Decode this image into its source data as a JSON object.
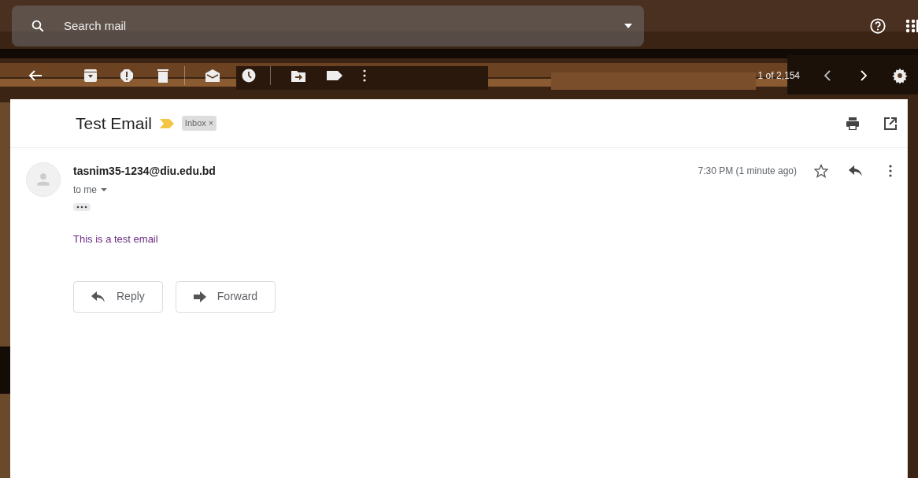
{
  "search": {
    "placeholder": "Search mail"
  },
  "toolbar": {
    "pagination": "1 of 2,154"
  },
  "message": {
    "subject": "Test Email",
    "important": true,
    "labels": [
      {
        "text": "Inbox",
        "close": "×"
      }
    ],
    "sender": "tasnim35-1234@diu.edu.bd",
    "recipient": "to me",
    "time": "7:30 PM (1 minute ago)",
    "starred": false,
    "body": "This is a test email"
  },
  "actions": [
    {
      "label": "Reply",
      "kind": "reply"
    },
    {
      "label": "Forward",
      "kind": "forward"
    }
  ]
}
